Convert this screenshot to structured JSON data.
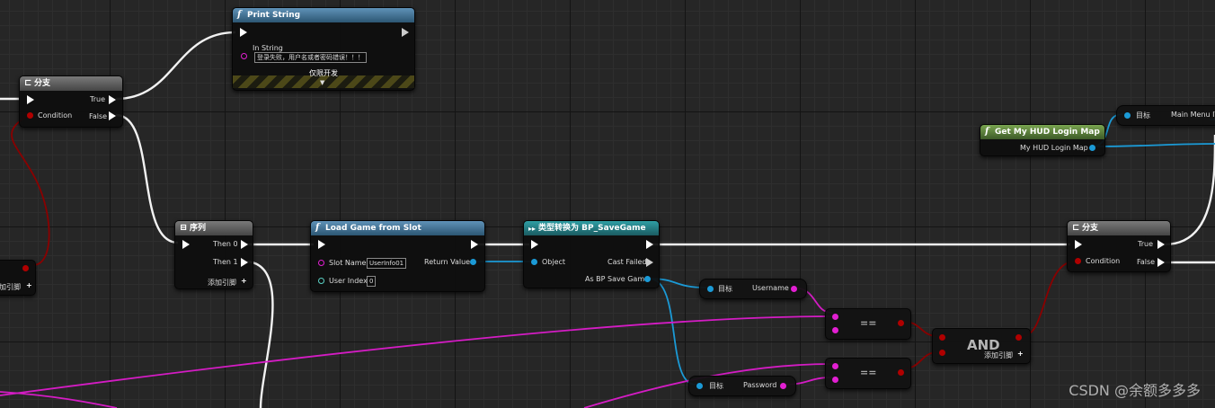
{
  "nodes": {
    "print_string": {
      "title": "Print String",
      "icon": "f",
      "in_string_label": "In String",
      "in_string_value": "登录失败，用户名或者密码错误！！！",
      "dev_only": "仅限开发"
    },
    "branch_left": {
      "title": "分支",
      "true_label": "True",
      "false_label": "False",
      "condition_label": "Condition"
    },
    "partial_node": {
      "add_pin": "加引脚"
    },
    "sequence": {
      "title": "序列",
      "then0": "Then 0",
      "then1": "Then 1",
      "add_pin": "添加引脚"
    },
    "load_game": {
      "title": "Load Game from Slot",
      "icon": "f",
      "slot_name_label": "Slot Name",
      "slot_name_value": "UserInfo01",
      "user_index_label": "User Index",
      "user_index_value": "0",
      "return_label": "Return Value"
    },
    "cast": {
      "title": "类型转换为 BP_SaveGame",
      "object_label": "Object",
      "cast_failed_label": "Cast Failed",
      "as_label": "As BP Save Game"
    },
    "get_username": {
      "target_label": "目标",
      "value_label": "Username"
    },
    "get_password": {
      "target_label": "目标",
      "value_label": "Password"
    },
    "equal_top": {
      "op": "=="
    },
    "equal_bottom": {
      "op": "=="
    },
    "and_node": {
      "op": "AND",
      "add_pin": "添加引脚"
    },
    "get_hud": {
      "title": "Get My HUD Login Map",
      "icon": "f",
      "out_label": "My HUD Login Map"
    },
    "main_menu": {
      "target_label": "目标",
      "value_label": "Main Menu IT"
    },
    "branch_right": {
      "title": "分支",
      "true_label": "True",
      "false_label": "False",
      "condition_label": "Condition"
    }
  },
  "watermark": "CSDN @余额多多多",
  "colors": {
    "exec": "#ffffff",
    "bool": "#b00000",
    "object": "#1b9ad6",
    "string": "#e21fd2",
    "integer": "#5ad0c4"
  }
}
